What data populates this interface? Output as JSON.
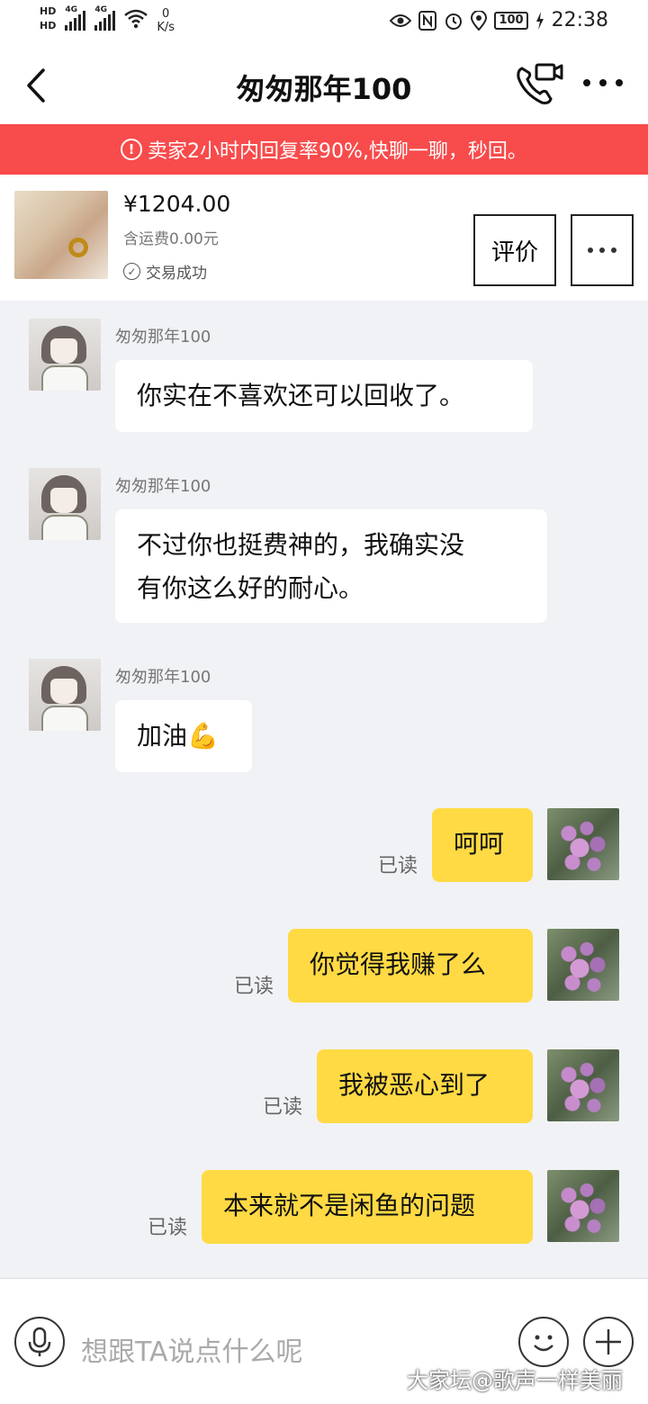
{
  "status_bar": {
    "hd1": "HD",
    "hd2": "HD",
    "sim1_label": "4G",
    "sim2_label": "4G",
    "speed_value": "0",
    "speed_unit": "K/s",
    "battery": "100",
    "time": "22:38",
    "icons": [
      "eye-icon",
      "nfc-icon",
      "alarm-icon",
      "location-icon",
      "charging-icon"
    ]
  },
  "header": {
    "title": "匆匆那年100",
    "icons": [
      "back-icon",
      "video-call-icon",
      "more-icon"
    ]
  },
  "notice": {
    "text": "卖家2小时内回复率90%,快聊一聊，秒回。",
    "color": "#f84b4b"
  },
  "product": {
    "price": "¥1204.00",
    "shipping": "含运费0.00元",
    "status": "交易成功",
    "rate_button": "评价"
  },
  "messages": {
    "in": [
      {
        "sender": "匆匆那年100",
        "lines": [
          "你实在不喜欢还可以回收了。"
        ]
      },
      {
        "sender": "匆匆那年100",
        "lines": [
          "不过你也挺费神的，我确实没",
          "有你这么好的耐心。"
        ]
      },
      {
        "sender": "匆匆那年100",
        "lines": [
          "加油💪"
        ]
      }
    ],
    "out": [
      {
        "text": "呵呵",
        "status": "已读"
      },
      {
        "text": "你觉得我赚了么",
        "status": "已读"
      },
      {
        "text": "我被恶心到了",
        "status": "已读"
      },
      {
        "text": "本来就不是闲鱼的问题",
        "status": "已读"
      }
    ],
    "bubble_out_color": "#ffda44"
  },
  "input": {
    "placeholder": "想跟TA说点什么呢"
  },
  "watermark": "大家坛@歌声一样美丽"
}
